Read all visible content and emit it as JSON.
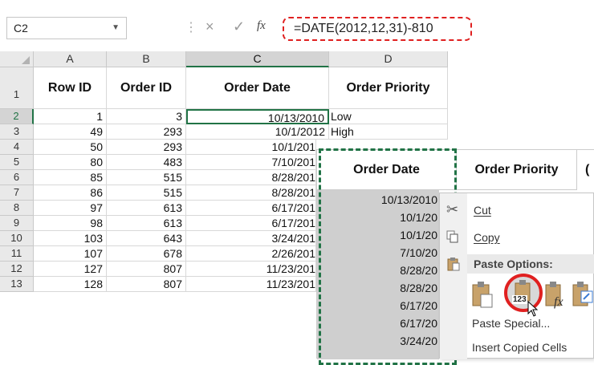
{
  "formula_bar": {
    "name_box": "C2",
    "cancel_icon": "×",
    "enter_icon": "✓",
    "function_icon": "fx",
    "formula": "=DATE(2012,12,31)-810"
  },
  "columns": [
    "A",
    "B",
    "C",
    "D"
  ],
  "header_row": {
    "row_num": "1",
    "row_id": "Row ID",
    "order_id": "Order ID",
    "order_date": "Order Date",
    "order_priority": "Order Priority"
  },
  "rows": [
    {
      "num": "2",
      "row_id": "1",
      "order_id": "3",
      "order_date": "10/13/2010",
      "order_priority": "Low"
    },
    {
      "num": "3",
      "row_id": "49",
      "order_id": "293",
      "order_date": "10/1/2012",
      "order_priority": "High"
    },
    {
      "num": "4",
      "row_id": "50",
      "order_id": "293",
      "order_date": "10/1/201",
      "order_priority": ""
    },
    {
      "num": "5",
      "row_id": "80",
      "order_id": "483",
      "order_date": "7/10/201",
      "order_priority": ""
    },
    {
      "num": "6",
      "row_id": "85",
      "order_id": "515",
      "order_date": "8/28/201",
      "order_priority": ""
    },
    {
      "num": "7",
      "row_id": "86",
      "order_id": "515",
      "order_date": "8/28/201",
      "order_priority": ""
    },
    {
      "num": "8",
      "row_id": "97",
      "order_id": "613",
      "order_date": "6/17/201",
      "order_priority": ""
    },
    {
      "num": "9",
      "row_id": "98",
      "order_id": "613",
      "order_date": "6/17/201",
      "order_priority": ""
    },
    {
      "num": "10",
      "row_id": "103",
      "order_id": "643",
      "order_date": "3/24/201",
      "order_priority": ""
    },
    {
      "num": "11",
      "row_id": "107",
      "order_id": "678",
      "order_date": "2/26/201",
      "order_priority": ""
    },
    {
      "num": "12",
      "row_id": "127",
      "order_id": "807",
      "order_date": "11/23/201",
      "order_priority": ""
    },
    {
      "num": "13",
      "row_id": "128",
      "order_id": "807",
      "order_date": "11/23/201",
      "order_priority": ""
    }
  ],
  "overlay": {
    "order_date_header": "Order Date",
    "order_priority_header": "Order Priority",
    "next_header_partial": "(",
    "values": [
      "10/13/2010",
      "10/1/20",
      "10/1/20",
      "7/10/20",
      "8/28/20",
      "8/28/20",
      "6/17/20",
      "6/17/20",
      "3/24/20"
    ]
  },
  "context_menu": {
    "cut": "Cut",
    "copy": "Copy",
    "paste_options": "Paste Options:",
    "paste_values_badge": "123",
    "paste_special": "Paste Special...",
    "insert_copied_cells": "Insert Copied Cells"
  },
  "colors": {
    "highlight": "#e02020",
    "selection": "#217346",
    "header_bg": "#e9e9e9",
    "copied_fill": "#cfcfcf"
  }
}
